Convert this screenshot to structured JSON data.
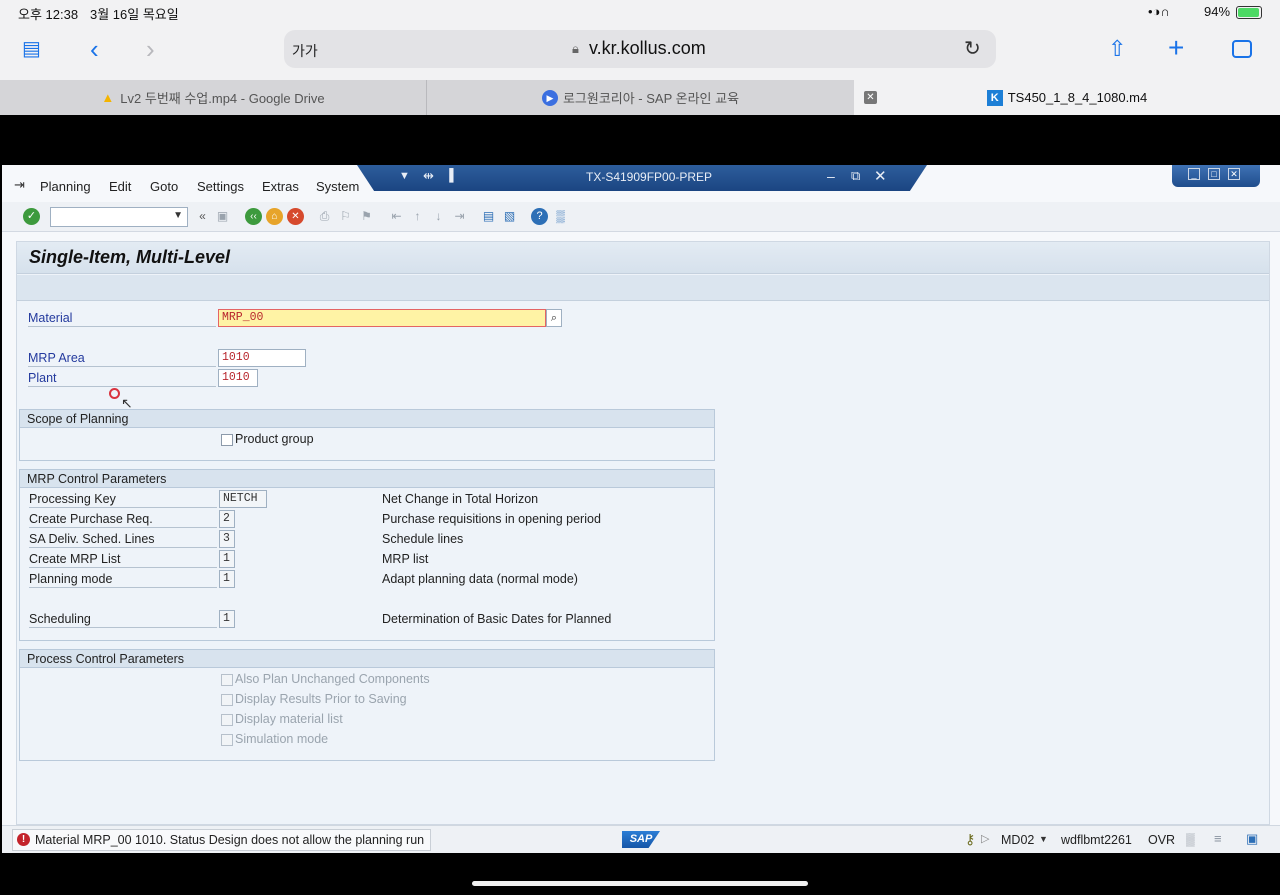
{
  "ios_status": {
    "time": "오후 12:38",
    "date": "3월 16일 목요일",
    "battery": "94%"
  },
  "safari": {
    "text_size": "가가",
    "url": "v.kr.kollus.com",
    "tabs": [
      {
        "label": "Lv2 두번째 수업.mp4 - Google Drive",
        "icon": "google-drive-icon"
      },
      {
        "label": "로그원코리아 - SAP 온라인 교육",
        "icon": "play-icon"
      },
      {
        "label": "TS450_1_8_4_1080.m4",
        "icon": "kollus-icon"
      }
    ]
  },
  "sap": {
    "system_title": "TX-S41909FP00-PREP",
    "menu": [
      "Planning",
      "Edit",
      "Goto",
      "Settings",
      "Extras",
      "System"
    ],
    "screen_title": "Single-Item, Multi-Level",
    "fields": {
      "material": {
        "label": "Material",
        "value": "MRP_00"
      },
      "mrp_area": {
        "label": "MRP Area",
        "value": "1010"
      },
      "plant": {
        "label": "Plant",
        "value": "1010"
      }
    },
    "scope": {
      "title": "Scope of Planning",
      "product_group": "Product group"
    },
    "control": {
      "title": "MRP Control Parameters",
      "rows": [
        {
          "label": "Processing Key",
          "value": "NETCH",
          "desc": "Net Change in Total Horizon"
        },
        {
          "label": "Create Purchase Req.",
          "value": "2",
          "desc": "Purchase requisitions in opening period"
        },
        {
          "label": "SA Deliv. Sched. Lines",
          "value": "3",
          "desc": "Schedule lines"
        },
        {
          "label": "Create MRP List",
          "value": "1",
          "desc": "MRP list"
        },
        {
          "label": "Planning mode",
          "value": "1",
          "desc": "Adapt planning data (normal mode)"
        },
        {
          "label": "Scheduling",
          "value": "1",
          "desc": "Determination of Basic Dates for Planned"
        }
      ]
    },
    "process": {
      "title": "Process Control Parameters",
      "options": [
        "Also Plan Unchanged Components",
        "Display Results Prior to Saving",
        "Display material list",
        "Simulation mode"
      ]
    },
    "statusbar": {
      "message": "Material MRP_00 1010. Status Design does not allow the planning run",
      "logo": "SAP",
      "transaction": "MD02",
      "user": "wdflbmt2261",
      "mode": "OVR"
    }
  }
}
